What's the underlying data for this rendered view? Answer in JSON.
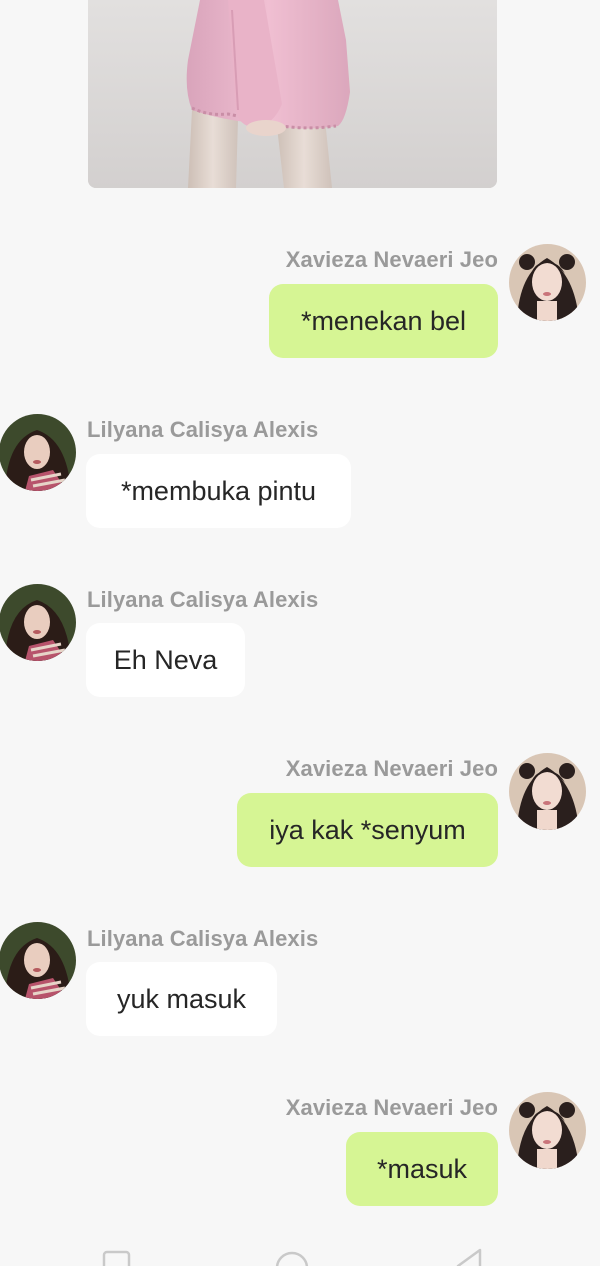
{
  "participants": {
    "self": {
      "name": "Xavieza Nevaeri Jeo",
      "avatar_icon": "avatar-xavieza-icon"
    },
    "other": {
      "name": "Lilyana Calisya Alexis",
      "avatar_icon": "avatar-lilyana-icon"
    }
  },
  "messages": [
    {
      "sender": "Xavieza Nevaeri Jeo",
      "text": "*menekan bel",
      "direction": "out"
    },
    {
      "sender": "Lilyana Calisya Alexis",
      "text": "*membuka pintu",
      "direction": "in"
    },
    {
      "sender": "Lilyana Calisya Alexis",
      "text": "Eh Neva",
      "direction": "in"
    },
    {
      "sender": "Xavieza Nevaeri Jeo",
      "text": "iya kak *senyum",
      "direction": "out"
    },
    {
      "sender": "Lilyana Calisya Alexis",
      "text": "yuk masuk",
      "direction": "in"
    },
    {
      "sender": "Xavieza Nevaeri Jeo",
      "text": "*masuk",
      "direction": "out"
    }
  ],
  "colors": {
    "background": "#f7f7f7",
    "outgoing_bubble": "#d6f594",
    "incoming_bubble": "#ffffff",
    "sender_name": "#9a9a9a",
    "message_text": "#262626"
  },
  "nav_bar": {
    "buttons": [
      "recent-apps-icon",
      "home-icon",
      "back-icon"
    ]
  }
}
